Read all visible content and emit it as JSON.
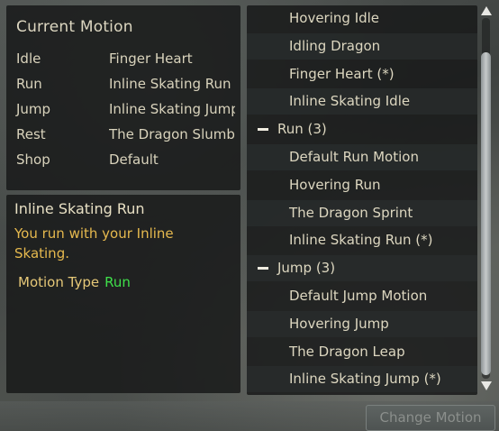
{
  "current_motion": {
    "title": "Current Motion",
    "rows": [
      {
        "label": "Idle",
        "value": "Finger Heart"
      },
      {
        "label": "Run",
        "value": "Inline Skating Run"
      },
      {
        "label": "Jump",
        "value": "Inline Skating Jump"
      },
      {
        "label": "Rest",
        "value": "The Dragon Slumber"
      },
      {
        "label": "Shop",
        "value": "Default"
      }
    ]
  },
  "detail": {
    "title": "Inline Skating Run",
    "description": "You run with your Inline Skating.",
    "motion_type_label": "Motion Type",
    "motion_type_value": "Run"
  },
  "motion_list": [
    {
      "type": "item",
      "label": "Hovering Idle"
    },
    {
      "type": "item",
      "label": "Idling Dragon"
    },
    {
      "type": "item",
      "label": "Finger Heart (*)"
    },
    {
      "type": "item",
      "label": "Inline Skating Idle"
    },
    {
      "type": "group",
      "label": "Run (3)"
    },
    {
      "type": "item",
      "label": "Default Run Motion"
    },
    {
      "type": "item",
      "label": "Hovering Run"
    },
    {
      "type": "item",
      "label": "The Dragon Sprint"
    },
    {
      "type": "item",
      "label": "Inline Skating Run (*)"
    },
    {
      "type": "group",
      "label": "Jump (3)"
    },
    {
      "type": "item",
      "label": "Default Jump Motion"
    },
    {
      "type": "item",
      "label": "Hovering Jump"
    },
    {
      "type": "item",
      "label": "The Dragon Leap"
    },
    {
      "type": "item",
      "label": "Inline Skating Jump (*)"
    }
  ],
  "buttons": {
    "change_motion": "Change Motion"
  },
  "colors": {
    "description": "#e6b94e",
    "motion_type_value": "#3fe04a"
  },
  "icons": {
    "scroll_up": "triangle-up-icon",
    "scroll_down": "triangle-down-icon",
    "collapse": "minus-icon"
  }
}
